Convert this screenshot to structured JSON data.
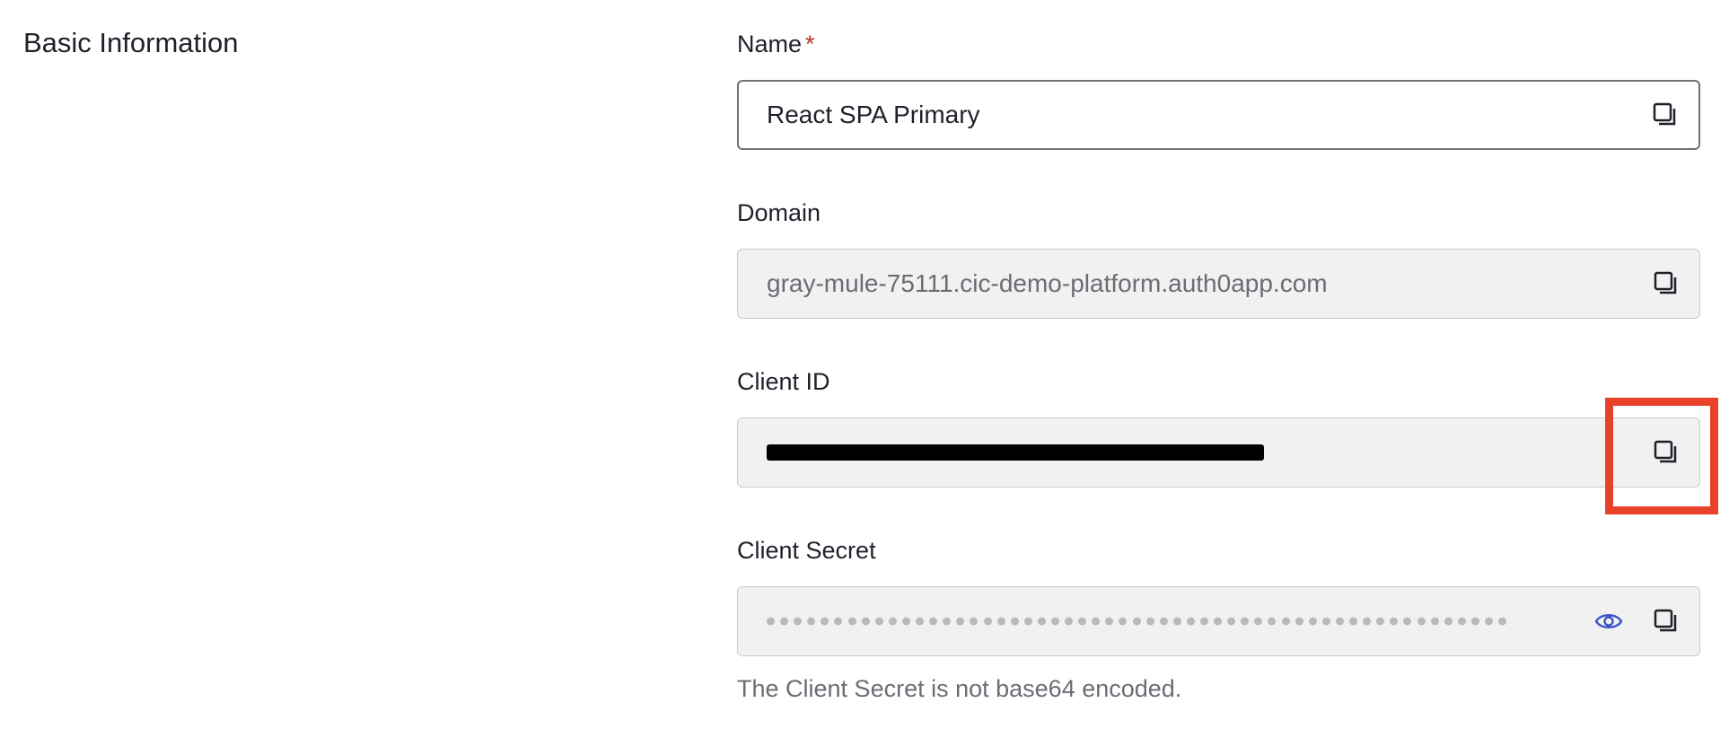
{
  "section": {
    "title": "Basic Information"
  },
  "fields": {
    "name": {
      "label": "Name",
      "required_mark": "*",
      "value": "React SPA Primary",
      "copy_icon": "copy-icon"
    },
    "domain": {
      "label": "Domain",
      "value": "gray-mule-75111.cic-demo-platform.auth0app.com",
      "copy_icon": "copy-icon"
    },
    "client_id": {
      "label": "Client ID",
      "copy_icon": "copy-icon"
    },
    "client_secret": {
      "label": "Client Secret",
      "reveal_icon": "eye-icon",
      "copy_icon": "copy-icon",
      "helper": "The Client Secret is not base64 encoded."
    }
  },
  "colors": {
    "required": "#b93222",
    "highlight": "#e8432a",
    "eye_icon": "#3b54c7"
  }
}
